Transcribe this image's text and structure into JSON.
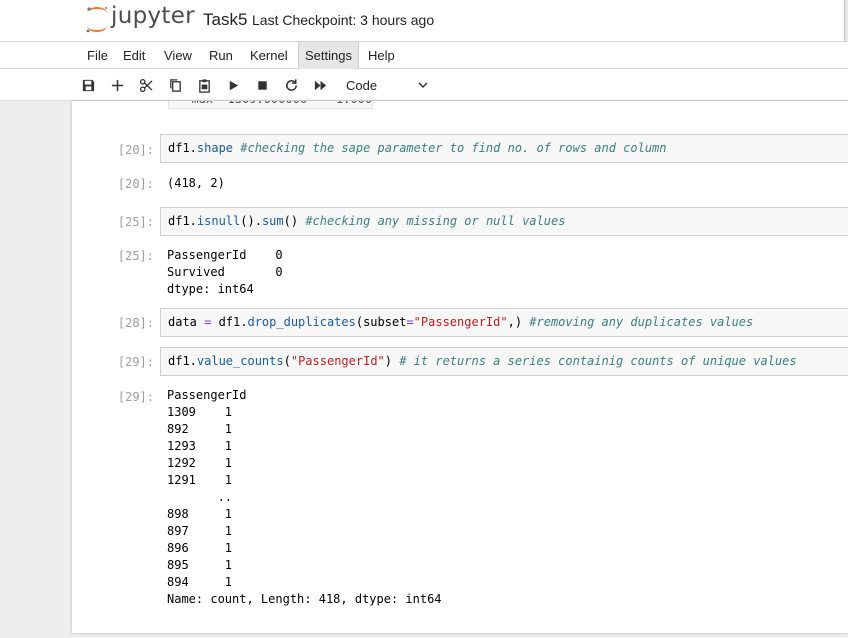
{
  "header": {
    "logo_text": "jupyter",
    "notebook_title": "Task5",
    "checkpoint": "Last Checkpoint: 3 hours ago"
  },
  "menu": [
    "File",
    "Edit",
    "View",
    "Run",
    "Kernel",
    "Settings",
    "Help"
  ],
  "toolbar": {
    "cell_type": "Code",
    "icons": [
      "save-icon",
      "add-icon",
      "cut-icon",
      "copy-icon",
      "paste-icon",
      "run-icon",
      "stop-icon",
      "restart-icon",
      "fast-forward-icon"
    ]
  },
  "cells": [
    {
      "prompt": "[20]:",
      "code": {
        "obj": "df1.",
        "attr": "shape",
        "comment": " #checking the sape parameter to find no. of rows and column"
      },
      "out_prompt": "[20]:",
      "output": [
        "(418, 2)"
      ]
    },
    {
      "prompt": "[25]:",
      "code": {
        "obj": "df1.",
        "attr": "isnull",
        "rest": "().",
        "attr2": "sum",
        "rest2": "() ",
        "comment": "#checking any missing or null values"
      },
      "out_prompt": "[25]:",
      "output": [
        "PassengerId    0",
        "Survived       0",
        "dtype: int64"
      ]
    },
    {
      "prompt": "[28]:",
      "code": {
        "obj": "data ",
        "op": "=",
        "pre": " df1.",
        "attr": "drop_duplicates",
        "pre2": "(subset",
        "op2": "=",
        "str": "\"PassengerId\"",
        "rest": ",) ",
        "comment": "#removing any duplicates values"
      }
    },
    {
      "prompt": "[29]:",
      "code": {
        "obj": "df1.",
        "attr": "value_counts",
        "pre": "(",
        "str": "\"PassengerId\"",
        "rest": ") ",
        "comment": "# it returns a series containig counts of unique values"
      },
      "out_prompt": "[29]:",
      "output": [
        "PassengerId",
        "1309    1",
        "892     1",
        "1293    1",
        "1292    1",
        "1291    1",
        "       ..",
        "898     1",
        "897     1",
        "896     1",
        "895     1",
        "894     1",
        "Name: count, Length: 418, dtype: int64"
      ]
    }
  ]
}
